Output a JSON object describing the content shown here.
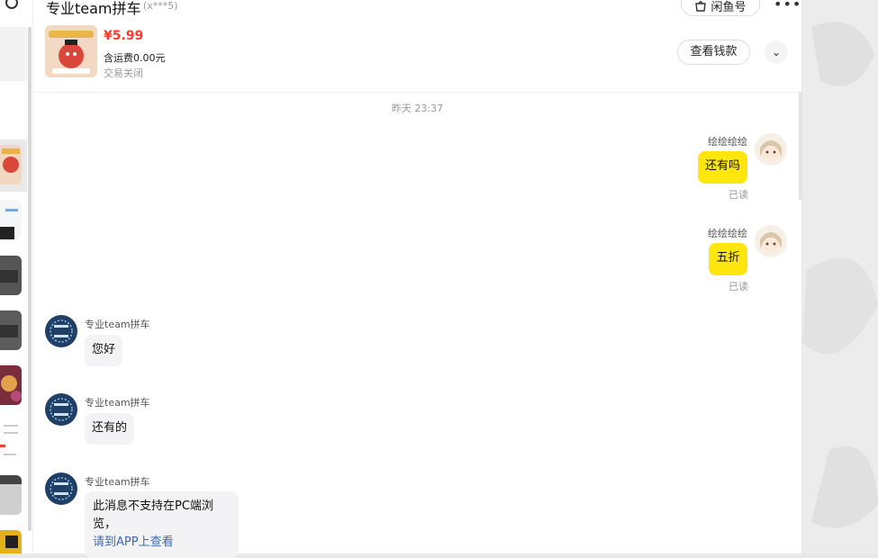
{
  "header": {
    "title": "专业team拼车",
    "user_id": "(x***5)",
    "xianyu_label": "闲鱼号",
    "more_icon": "more-dots-icon",
    "product": {
      "price": "¥5.99",
      "shipping": "含运费0.00元",
      "status": "交易关闭"
    },
    "view_payment_label": "查看钱款",
    "expand_icon": "chevron-down-icon"
  },
  "chat": {
    "timestamp": "昨天 23:37",
    "messages": [
      {
        "side": "me",
        "name": "绘绘绘绘",
        "text": "还有吗",
        "read": "已读"
      },
      {
        "side": "me",
        "name": "绘绘绘绘",
        "text": "五折",
        "read": "已读"
      },
      {
        "side": "other",
        "name": "专业team拼车",
        "text": "您好"
      },
      {
        "side": "other",
        "name": "专业team拼车",
        "text": "还有的"
      },
      {
        "side": "other",
        "name": "专业team拼车",
        "text": "此消息不支持在PC端浏览，",
        "link": "请到APP上查看"
      }
    ]
  },
  "colors": {
    "accent_yellow": "#ffe60f",
    "price_red": "#ff3b30",
    "link_blue": "#3d6bb3"
  }
}
